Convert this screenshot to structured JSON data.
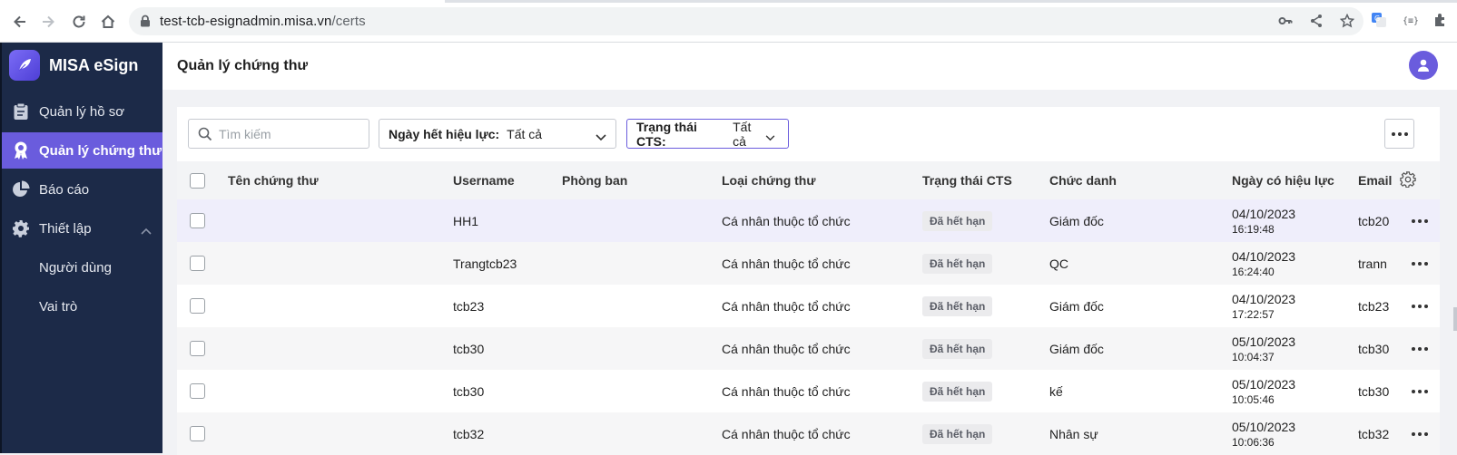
{
  "browser": {
    "url_host": "test-tcb-esignadmin.misa.vn",
    "url_path": "/certs"
  },
  "app": {
    "name": "MISA eSign"
  },
  "sidebar": {
    "items": [
      {
        "label": "Quản lý hồ sơ",
        "icon": "clipboard-icon"
      },
      {
        "label": "Quản lý chứng thư",
        "icon": "certificate-icon",
        "active": true
      },
      {
        "label": "Báo cáo",
        "icon": "pie-chart-icon"
      },
      {
        "label": "Thiết lập",
        "icon": "gear-icon",
        "expanded": true
      }
    ],
    "subitems": [
      {
        "label": "Người dùng"
      },
      {
        "label": "Vai trò"
      }
    ]
  },
  "header": {
    "title": "Quản lý chứng thư"
  },
  "toolbar": {
    "search_placeholder": "Tìm kiếm",
    "filters": [
      {
        "label": "Ngày hết hiệu lực:",
        "value": "Tất cả"
      },
      {
        "label": "Trạng thái CTS:",
        "value": "Tất cả"
      }
    ]
  },
  "table": {
    "columns": [
      "Tên chứng thư",
      "Username",
      "Phòng ban",
      "Loại chứng thư",
      "Trạng thái CTS",
      "Chức danh",
      "Ngày có hiệu lực",
      "Email"
    ],
    "rows": [
      {
        "name": "",
        "username": "HH1",
        "department": "",
        "type": "Cá nhân thuộc tổ chức",
        "status": "Đã hết hạn",
        "title": "Giám đốc",
        "date": "04/10/2023",
        "time": "16:19:48",
        "email": "tcb20"
      },
      {
        "name": "",
        "username": "Trangtcb23",
        "department": "",
        "type": "Cá nhân thuộc tổ chức",
        "status": "Đã hết hạn",
        "title": "QC",
        "date": "04/10/2023",
        "time": "16:24:40",
        "email": "trann"
      },
      {
        "name": "",
        "username": "tcb23",
        "department": "",
        "type": "Cá nhân thuộc tổ chức",
        "status": "Đã hết hạn",
        "title": "Giám đốc",
        "date": "04/10/2023",
        "time": "17:22:57",
        "email": "tcb23"
      },
      {
        "name": "",
        "username": "tcb30",
        "department": "",
        "type": "Cá nhân thuộc tổ chức",
        "status": "Đã hết hạn",
        "title": "Giám đốc",
        "date": "05/10/2023",
        "time": "10:04:37",
        "email": "tcb30"
      },
      {
        "name": "",
        "username": "tcb30",
        "department": "",
        "type": "Cá nhân thuộc tổ chức",
        "status": "Đã hết hạn",
        "title": "kế",
        "date": "05/10/2023",
        "time": "10:05:46",
        "email": "tcb30"
      },
      {
        "name": "",
        "username": "tcb32",
        "department": "",
        "type": "Cá nhân thuộc tổ chức",
        "status": "Đã hết hạn",
        "title": "Nhân sự",
        "date": "05/10/2023",
        "time": "10:06:36",
        "email": "tcb32"
      }
    ]
  },
  "colors": {
    "sidebar_bg": "#1c2a48",
    "accent": "#6a5cdd"
  }
}
